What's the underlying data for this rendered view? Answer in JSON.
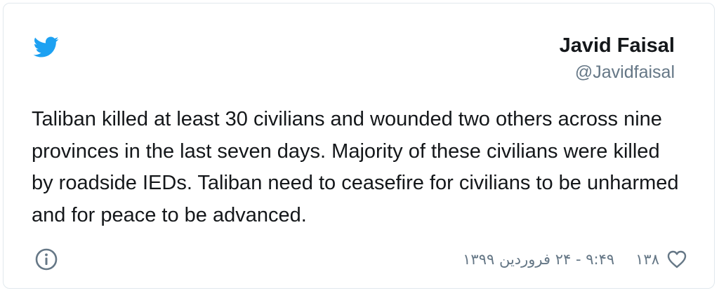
{
  "author": {
    "name": "Javid Faisal",
    "handle": "@Javidfaisal"
  },
  "tweet": {
    "text": "Taliban killed at least 30 civilians and wounded two others across nine provinces in the last seven days. Majority of these civilians were killed by roadside IEDs. Taliban need to ceasefire for civilians to be unharmed and for peace to be advanced."
  },
  "footer": {
    "timestamp": "۹:۴۹ - ۲۴ فروردین ۱۳۹۹",
    "like_count": "۱۳۸"
  },
  "colors": {
    "brand": "#1da1f2",
    "text": "#14171a",
    "secondary": "#657786",
    "border": "#e1e8ed"
  },
  "icons": {
    "logo": "twitter-bird-icon",
    "info": "info-icon",
    "like": "heart-icon"
  }
}
